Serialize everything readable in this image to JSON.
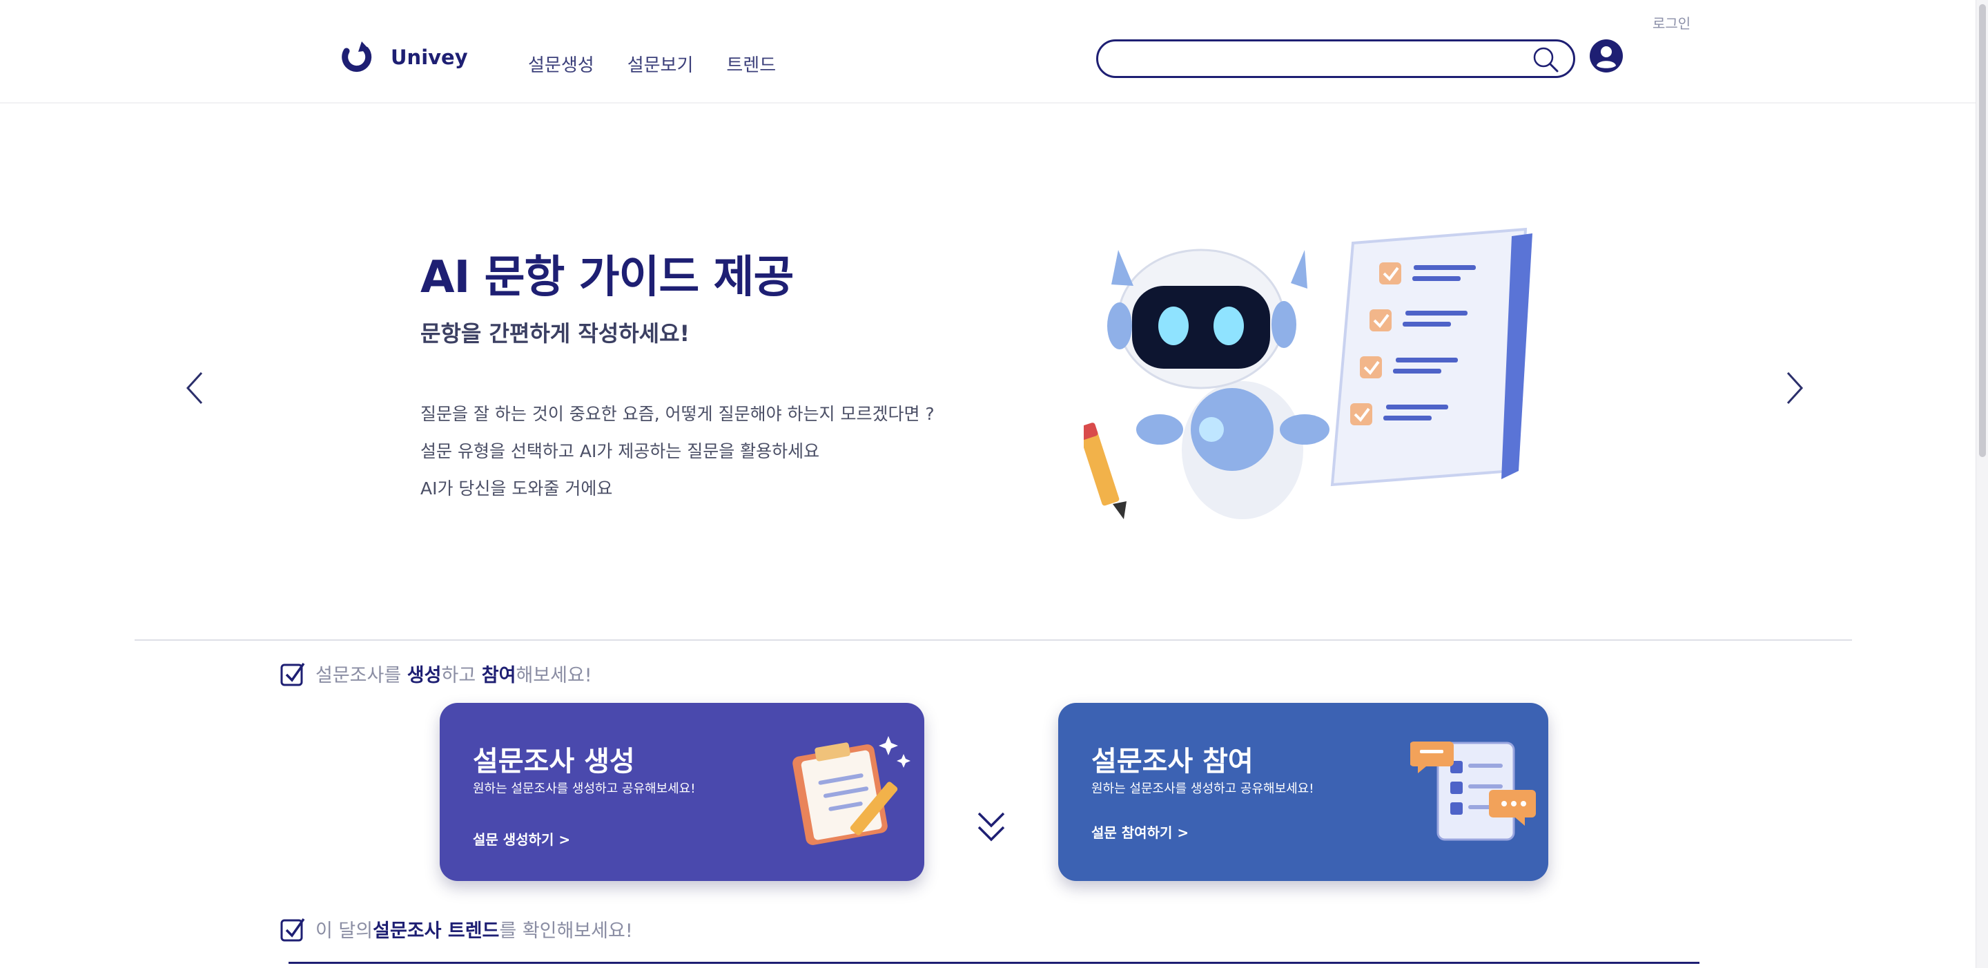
{
  "header": {
    "login_label": "로그인",
    "logo_text": "Univey",
    "nav": [
      "설문생성",
      "설문보기",
      "트렌드"
    ],
    "search": {
      "value": "",
      "placeholder": ""
    },
    "accent_color": "#1e1f73"
  },
  "hero": {
    "title": "AI 문항 가이드 제공",
    "subtitle": "문항을 간편하게 작성하세요!",
    "lines": [
      "질문을 잘 하는 것이 중요한 요즘, 어떻게 질문해야 하는지 모르겠다면 ?",
      "설문 유형을 선택하고 AI가 제공하는 질문을 활용하세요",
      "AI가 당신을 도와줄 거에요"
    ],
    "illustration_icon": "robot-with-checklist-icon"
  },
  "section_participate": {
    "parts": [
      "설문조사를 ",
      "생성",
      "하고 ",
      "참여",
      "해보세요!"
    ]
  },
  "cards": {
    "create": {
      "title": "설문조사 생성",
      "desc": "원하는 설문조사를 생성하고 공유해보세요!",
      "link": "설문 생성하기 >",
      "color": "#4a49ad",
      "icon": "clipboard-pencil-icon"
    },
    "join": {
      "title": "설문조사 참여",
      "desc": "원하는 설문조사를 생성하고 공유해보세요!",
      "link": "설문 참여하기 >",
      "color": "#3c62b3",
      "icon": "checklist-chat-icon"
    }
  },
  "section_trend": {
    "parts": [
      "이 달의",
      "설문조사 트렌드",
      "를 확인해보세요!"
    ]
  }
}
